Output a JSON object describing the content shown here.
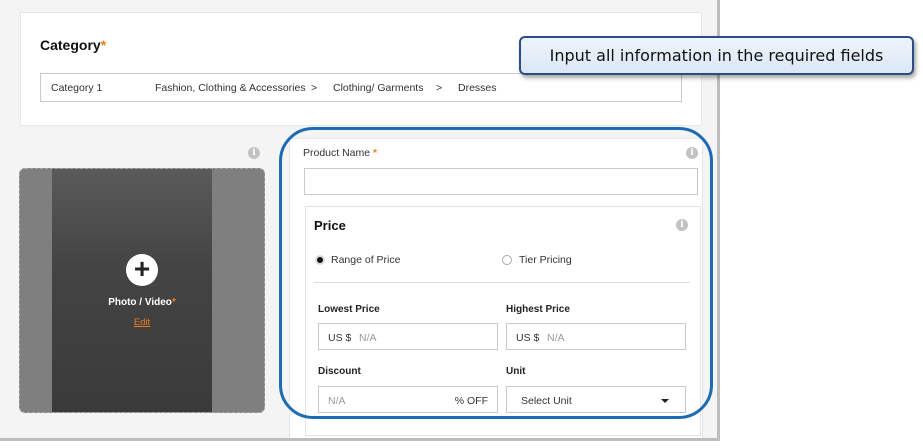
{
  "category": {
    "title": "Category",
    "required_mark": "*",
    "level": "Category 1",
    "path": [
      "Fashion, Clothing & Accessories",
      ">",
      "Clothing/ Garments",
      ">",
      "Dresses"
    ]
  },
  "media": {
    "label": "Photo / Video",
    "required_mark": "*",
    "edit": "Edit",
    "plus": "+"
  },
  "product": {
    "name_label": "Product Name",
    "required_mark": "*",
    "name_value": ""
  },
  "price": {
    "title": "Price",
    "options": [
      {
        "label": "Range of Price",
        "selected": true
      },
      {
        "label": "Tier Pricing",
        "selected": false
      }
    ],
    "lowest": {
      "label": "Lowest Price",
      "currency": "US $",
      "placeholder": "N/A"
    },
    "highest": {
      "label": "Highest Price",
      "currency": "US $",
      "placeholder": "N/A"
    },
    "discount": {
      "label": "Discount",
      "placeholder": "N/A",
      "suffix": "% OFF"
    },
    "unit": {
      "label": "Unit",
      "selected": "Select Unit"
    }
  },
  "icons": {
    "info": "i"
  },
  "callout": {
    "text": "Input all information in the required fields"
  },
  "colors": {
    "accent": "#f07f1a",
    "highlight": "#1c6bb3",
    "callout_border": "#2a4d86"
  }
}
